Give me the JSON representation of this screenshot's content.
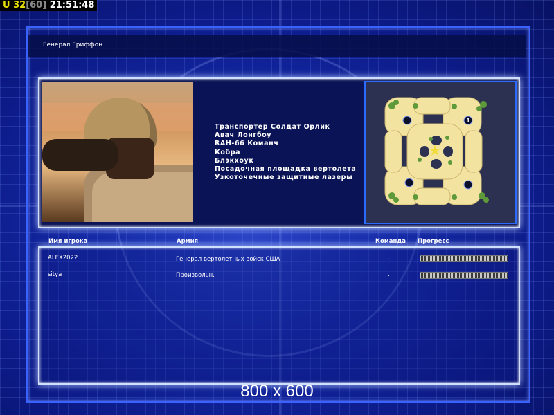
{
  "hud": {
    "unit_label": "U 32",
    "fps": "[60]",
    "time": "21:51:48"
  },
  "title": "Генерал Гриффон",
  "units": [
    "Транспортер Солдат Орлик",
    "Авач Лонгбоу",
    "RAH-66 Команч",
    "Кобра",
    "Блэкхоук",
    "Посадочная площадка вертолета",
    "Узкоточечные защитные лазеры"
  ],
  "map": {
    "start_marker": "1"
  },
  "players_table": {
    "headers": {
      "name": "Имя игрока",
      "army": "Армия",
      "team": "Команда",
      "progress": "Прогресс"
    },
    "rows": [
      {
        "name": "ALEX2022",
        "army": "Генерал вертолетных войск США",
        "team": ".",
        "progress": 1.0
      },
      {
        "name": "sitya",
        "army": "Произвольн.",
        "team": ".",
        "progress": 1.0
      }
    ]
  },
  "resolution_label": "800 x 600",
  "colors": {
    "hud_yellow": "#e8e000",
    "frame_blue": "#3a62ff",
    "panel_glow": "#cfe0ff"
  }
}
